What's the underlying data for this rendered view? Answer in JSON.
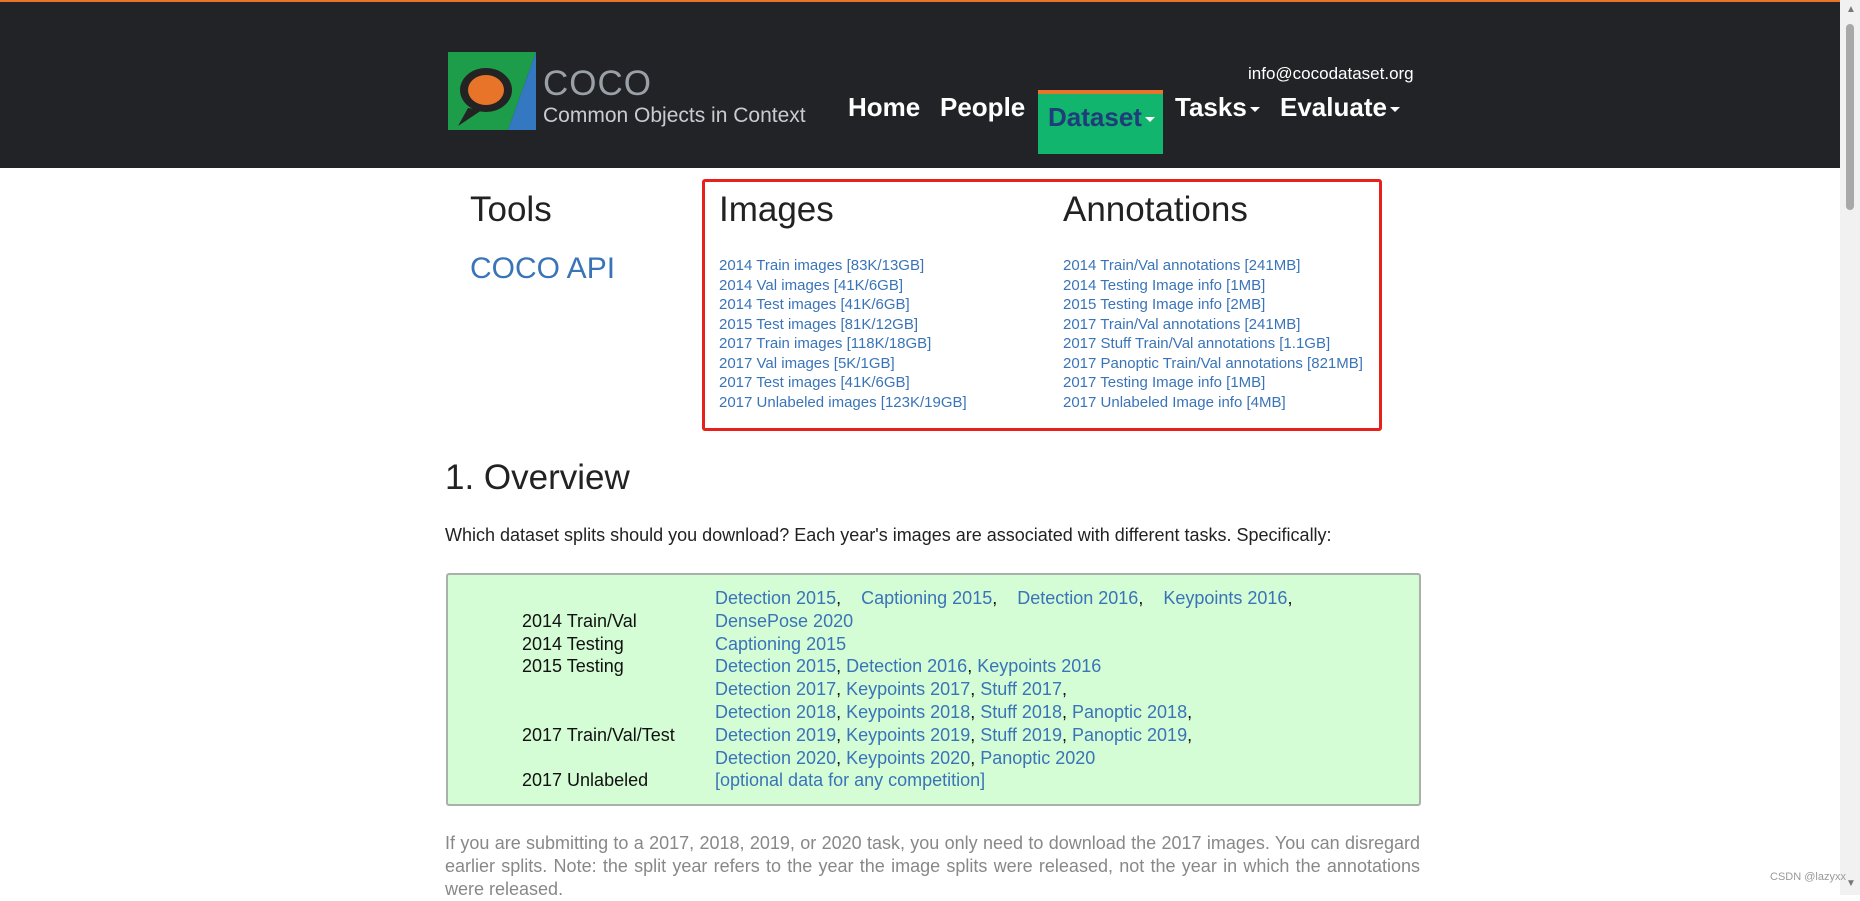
{
  "header": {
    "logo_title": "COCO",
    "logo_subtitle": "Common Objects in Context",
    "email": "info@cocodataset.org",
    "nav": {
      "home": "Home",
      "people": "People",
      "dataset": "Dataset",
      "tasks": "Tasks",
      "evaluate": "Evaluate"
    },
    "accent_color": "#e8742a",
    "active_nav_color": "#12b56e"
  },
  "tools": {
    "title": "Tools",
    "coco_api": "COCO API"
  },
  "images": {
    "title": "Images",
    "links": [
      "2014 Train images [83K/13GB]",
      "2014 Val images [41K/6GB]",
      "2014 Test images [41K/6GB]",
      "2015 Test images [81K/12GB]",
      "2017 Train images [118K/18GB]",
      "2017 Val images [5K/1GB]",
      "2017 Test images [41K/6GB]",
      "2017 Unlabeled images [123K/19GB]"
    ]
  },
  "annotations": {
    "title": "Annotations",
    "links": [
      "2014 Train/Val annotations [241MB]",
      "2014 Testing Image info [1MB]",
      "2015 Testing Image info [2MB]",
      "2017 Train/Val annotations [241MB]",
      "2017 Stuff Train/Val annotations [1.1GB]",
      "2017 Panoptic Train/Val annotations [821MB]",
      "2017 Testing Image info [1MB]",
      "2017 Unlabeled Image info [4MB]"
    ]
  },
  "overview": {
    "title": "1. Overview",
    "intro": "Which dataset splits should you download? Each year's images are associated with different tasks. Specifically:",
    "splits": [
      "2014 Train/Val",
      "2014 Testing",
      "2015 Testing",
      "2017 Train/Val/Test",
      "2017 Unlabeled"
    ],
    "tasks": {
      "t2014a": [
        "Detection 2015",
        "Captioning 2015",
        "Detection 2016",
        "Keypoints 2016"
      ],
      "t2014b": "DensePose 2020",
      "t2014test": "Captioning 2015",
      "t2015test": [
        "Detection 2015",
        "Detection 2016",
        "Keypoints 2016"
      ],
      "t2017_l1": [
        "Detection 2017",
        "Keypoints 2017",
        "Stuff 2017"
      ],
      "t2017_l2": [
        "Detection 2018",
        "Keypoints 2018",
        "Stuff 2018",
        "Panoptic 2018"
      ],
      "t2017_l3": [
        "Detection 2019",
        "Keypoints 2019",
        "Stuff 2019",
        "Panoptic 2019"
      ],
      "t2017_l4": [
        "Detection 2020",
        "Keypoints 2020",
        "Panoptic 2020"
      ],
      "t2017unl": "[optional data for any competition]"
    },
    "note": "If you are submitting to a 2017, 2018, 2019, or 2020 task, you only need to download the 2017 images. You can disregard earlier splits. Note: the split year refers to the year the image splits were released, not the year in which the annotations were released."
  },
  "watermark": "CSDN @lazyxx"
}
